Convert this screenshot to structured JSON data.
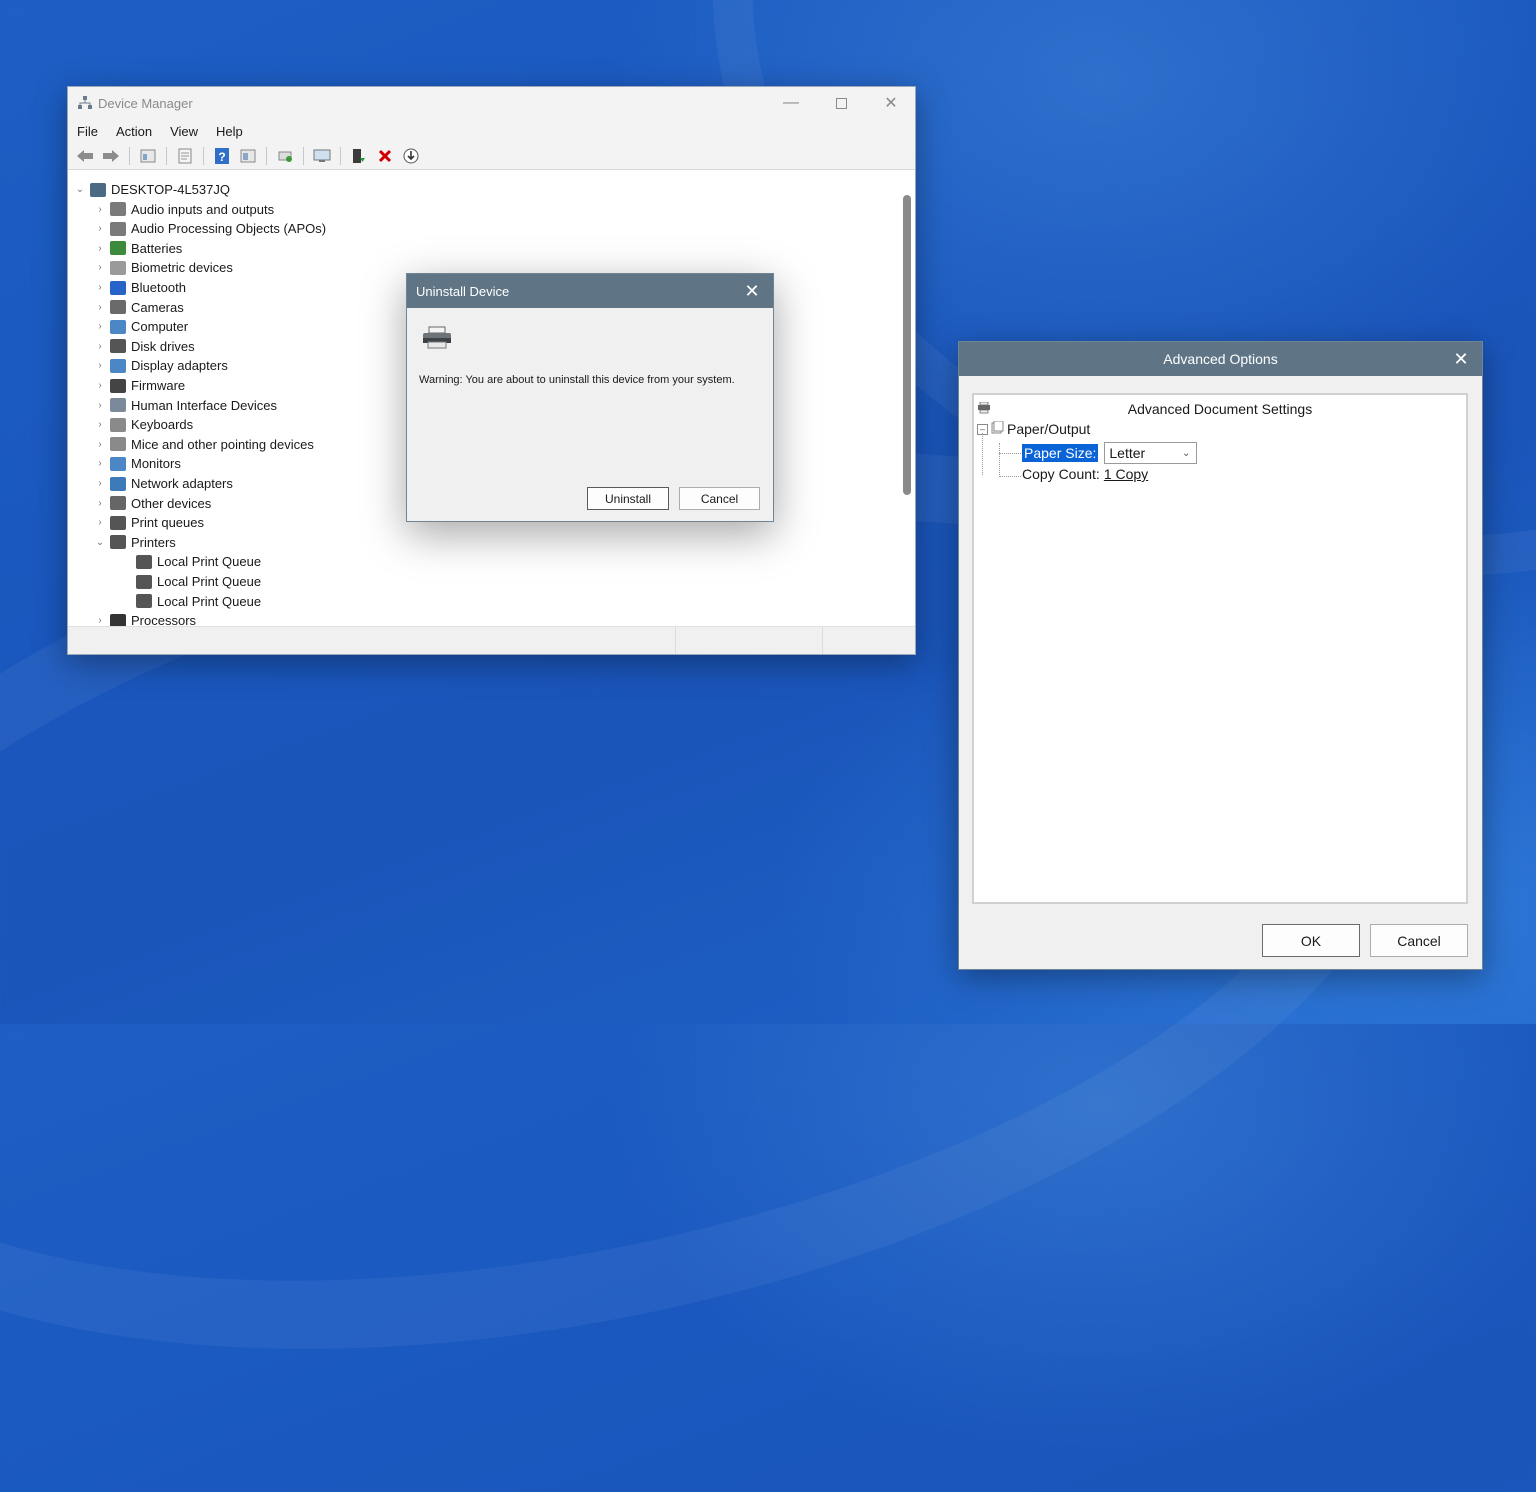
{
  "device_manager": {
    "title": "Device Manager",
    "menu": [
      "File",
      "Action",
      "View",
      "Help"
    ],
    "root": "DESKTOP-4L537JQ",
    "categories": [
      "Audio inputs and outputs",
      "Audio Processing Objects (APOs)",
      "Batteries",
      "Biometric devices",
      "Bluetooth",
      "Cameras",
      "Computer",
      "Disk drives",
      "Display adapters",
      "Firmware",
      "Human Interface Devices",
      "Keyboards",
      "Mice and other pointing devices",
      "Monitors",
      "Network adapters",
      "Other devices",
      "Print queues",
      "Printers",
      "Local Print Queue",
      "Local Print Queue",
      "Local Print Queue",
      "Processors"
    ]
  },
  "uninstall_dialog": {
    "title": "Uninstall Device",
    "warning": "Warning: You are about to uninstall this device from your system.",
    "uninstall_label": "Uninstall",
    "cancel_label": "Cancel"
  },
  "advanced_options": {
    "title": "Advanced Options",
    "heading": "Advanced Document Settings",
    "group": "Paper/Output",
    "paper_size_label": "Paper Size:",
    "paper_size_value": "Letter",
    "copy_count_label": "Copy Count:",
    "copy_count_value": "1 Copy",
    "ok_label": "OK",
    "cancel_label": "Cancel"
  },
  "colors": {
    "dialog_titlebar": "#5f7586",
    "selection": "#0a64d8",
    "delete_red": "#d40000"
  }
}
